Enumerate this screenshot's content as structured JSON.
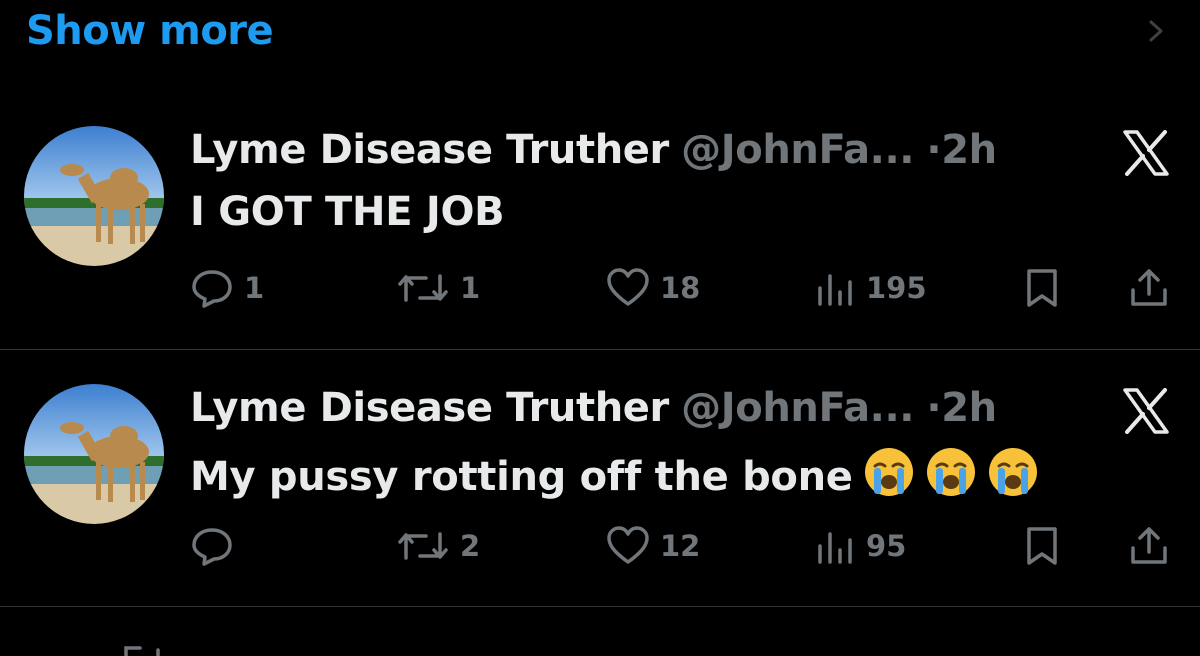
{
  "show_more": {
    "label": "Show more"
  },
  "tweets": [
    {
      "display_name": "Lyme Disease Truther",
      "handle": "@JohnFa...",
      "separator": "·",
      "time": "2h",
      "text": "I GOT THE JOB",
      "emojis": [],
      "counts": {
        "replies": "1",
        "reposts": "1",
        "likes": "18",
        "views": "195"
      }
    },
    {
      "display_name": "Lyme Disease Truther",
      "handle": "@JohnFa...",
      "separator": "·",
      "time": "2h",
      "text": "My pussy rotting off the bone",
      "emojis": [
        "loudly-crying-face",
        "loudly-crying-face",
        "loudly-crying-face"
      ],
      "counts": {
        "replies": "",
        "reposts": "2",
        "likes": "12",
        "views": "95"
      }
    }
  ],
  "colors": {
    "accent": "#1d9bf0",
    "muted": "#71767b",
    "text": "#e7e9ea",
    "background": "#000000"
  }
}
